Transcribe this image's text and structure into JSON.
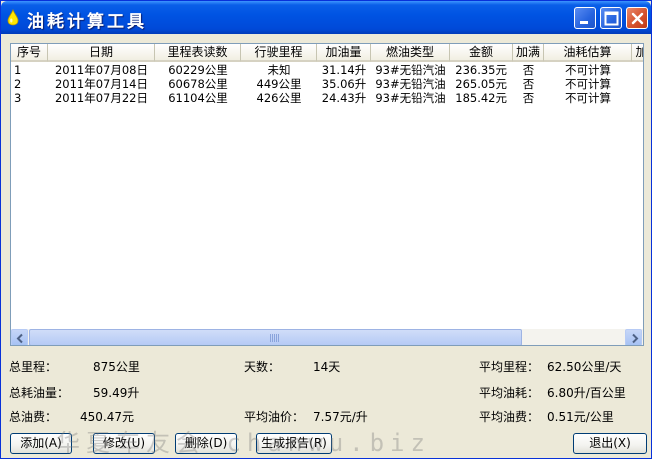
{
  "window": {
    "title": "油耗计算工具"
  },
  "table": {
    "columns": [
      {
        "label": "序号",
        "w": 37,
        "align": "left"
      },
      {
        "label": "日期",
        "w": 107,
        "align": "center"
      },
      {
        "label": "里程表读数",
        "w": 86,
        "align": "center"
      },
      {
        "label": "行驶里程",
        "w": 76,
        "align": "center"
      },
      {
        "label": "加油量",
        "w": 54,
        "align": "center"
      },
      {
        "label": "燃油类型",
        "w": 79,
        "align": "center"
      },
      {
        "label": "金额",
        "w": 63,
        "align": "right"
      },
      {
        "label": "加满",
        "w": 31,
        "align": "center"
      },
      {
        "label": "油耗估算",
        "w": 88,
        "align": "center"
      },
      {
        "label": "加",
        "w": 20,
        "align": "center"
      }
    ],
    "rows": [
      [
        "1",
        "2011年07月08日",
        "60229公里",
        "未知",
        "31.14升",
        "93#无铅汽油",
        "236.35元",
        "否",
        "不可计算",
        ""
      ],
      [
        "2",
        "2011年07月14日",
        "60678公里",
        "449公里",
        "35.06升",
        "93#无铅汽油",
        "265.05元",
        "否",
        "不可计算",
        ""
      ],
      [
        "3",
        "2011年07月22日",
        "61104公里",
        "426公里",
        "24.43升",
        "93#无铅汽油",
        "185.42元",
        "否",
        "不可计算",
        ""
      ]
    ]
  },
  "summary": {
    "total_mileage_label": "总里程：",
    "total_mileage": "875公里",
    "days_label": "天数：",
    "days": "14天",
    "avg_mileage_label": "平均里程：",
    "avg_mileage": "62.50公里/天",
    "total_fuel_label": "总耗油量：",
    "total_fuel": "59.49升",
    "avg_consumption_label": "平均油耗：",
    "avg_consumption": "6.80升/百公里",
    "total_cost_label": "总油费：",
    "total_cost": "450.47元",
    "avg_price_label": "平均油价：",
    "avg_price": "7.57元/升",
    "avg_cost_label": "平均油费：",
    "avg_cost": "0.51元/公里"
  },
  "buttons": {
    "add": "添加(A)",
    "edit": "修改(U)",
    "delete": "删除(D)",
    "report": "生成报告(R)",
    "exit": "退出(X)"
  },
  "watermark": "华夏车友会 chanwu.biz"
}
